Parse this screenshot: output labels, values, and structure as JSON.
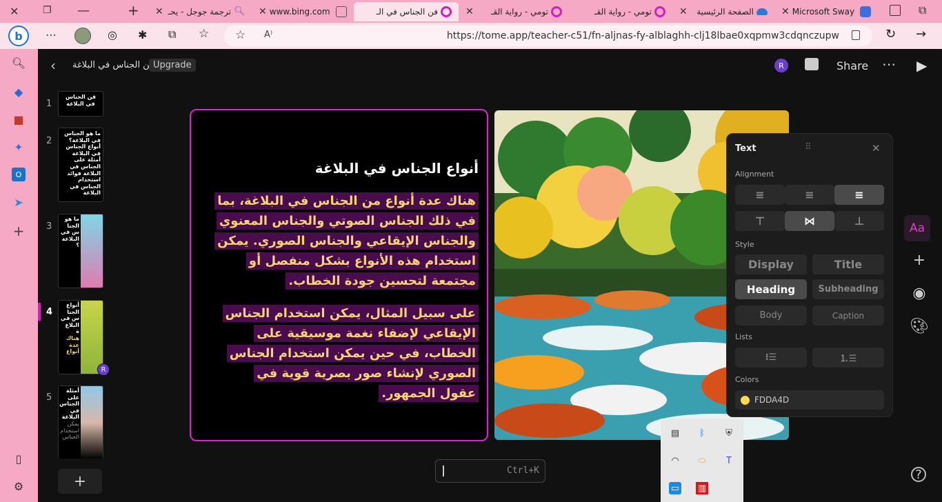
{
  "browser": {
    "tabs": [
      {
        "label": "ترجمة جوجل - يحـ",
        "icon": "google-translate-icon"
      },
      {
        "label": "www.bing.com",
        "icon": "bing-icon"
      },
      {
        "label": "فن الجناس في الـ",
        "icon": "tome-icon",
        "active": true
      },
      {
        "label": "تومي - رواية القـ",
        "icon": "tome-icon"
      },
      {
        "label": "تومي - رواية القـ",
        "icon": "tome-icon"
      },
      {
        "label": "الصفحة الرئيسية",
        "icon": "onedrive-icon"
      },
      {
        "label": "Microsoft Sway",
        "icon": "sway-icon"
      }
    ],
    "url": "https://tome.app/teacher-c51/fn-aljnas-fy-alblaghh-clj18lbae0xqpmw3cdqnczupw",
    "accent_color": "#f6a9c4"
  },
  "app": {
    "doc_title": "فن الجناس في البلاغة",
    "upgrade_label": "Upgrade",
    "avatar_letter": "R",
    "share_label": "Share"
  },
  "thumbnails": [
    {
      "num": "1",
      "text": "فن الجناس في البلاغة"
    },
    {
      "num": "2",
      "text": "ما هو الجناس في البلاغة؟ أنواع الجناس في البلاغة أمثلة على الجناس في البلاغة فوائد استخدام الجناس في البلاغة"
    },
    {
      "num": "3",
      "text": "ما هو الجنا س في البلاغة ؟"
    },
    {
      "num": "4",
      "text": "أنواع الجنا س في البلاغ ة",
      "sub": "هناك عدة أنواع",
      "active": true
    },
    {
      "num": "5",
      "text": "أمثلة على الجناس في البلاغة",
      "sub": "يمكن استخدام الجناس"
    }
  ],
  "slide": {
    "heading": "أنواع الجناس في البلاغة",
    "paragraph1": "هناك عدة أنواع من الجناس في البلاغة، بما في ذلك الجناس الصوتي والجناس المعنوي والجناس الإيقاعي والجناس الصوري. يمكن استخدام هذه الأنواع بشكل منفصل أو مجتمعة لتحسين جودة الخطاب.",
    "paragraph2": "على سبيل المثال، يمكن استخدام الجناس الإيقاعي لإضفاء نغمة موسيقية على الخطاب، في حين يمكن استخدام الجناس الصوري لإنشاء صور بصرية قوية في عقول الجمهور.",
    "text_color": "#FDDA4D",
    "highlight_color": "#4a0c4c",
    "border_color": "#e020d0"
  },
  "text_panel": {
    "title": "Text",
    "alignment_label": "Alignment",
    "style_label": "Style",
    "styles": [
      "Display",
      "Title",
      "Heading",
      "Subheading",
      "Body",
      "Caption"
    ],
    "selected_style": "Heading",
    "lists_label": "Lists",
    "colors_label": "Colors",
    "color_value": "FDDA4D",
    "color_hex": "#FDDA4D"
  },
  "right_toolbar": {
    "text_button": "Aa"
  },
  "cmdk": {
    "shortcut": "Ctrl+K"
  }
}
